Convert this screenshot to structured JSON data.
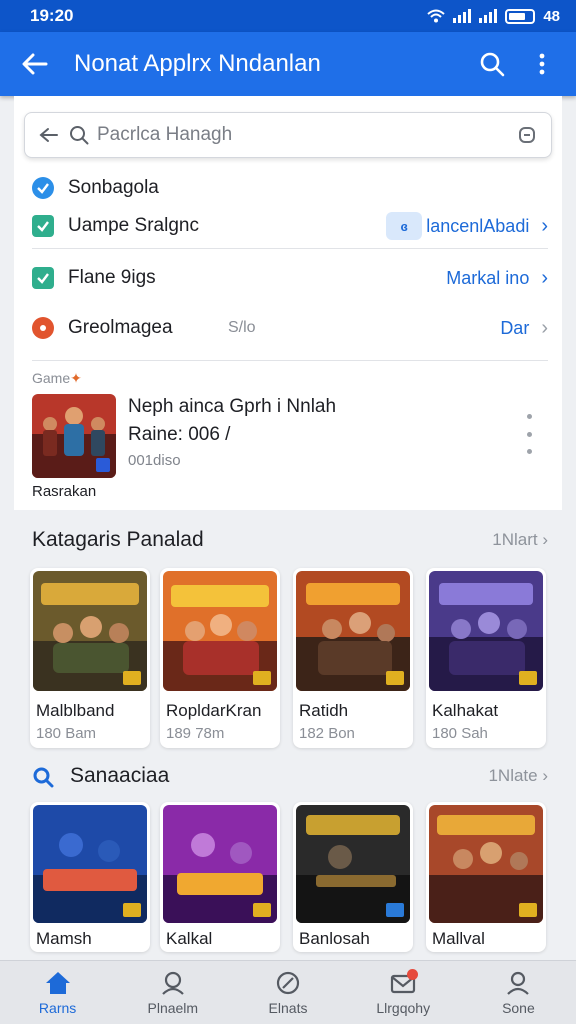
{
  "status_bar": {
    "time": "19:20",
    "battery": "48"
  },
  "app_bar": {
    "title": "Nonat Applrx Nndanlan"
  },
  "search": {
    "placeholder": "Pacrlca Hanagh"
  },
  "options": [
    {
      "label": "Sonbagola",
      "value": ""
    },
    {
      "label": "Uampe Sralgnc",
      "value": "lancenlAbadi"
    },
    {
      "label": "Flane 9igs",
      "value": "Markal ino"
    },
    {
      "label": "Greolmagea",
      "value": "Dar",
      "extra": "S/lo"
    }
  ],
  "game": {
    "section_label": "Game",
    "title": "Neph ainca Gprh i Nnlah",
    "rating": "Raine: 006  /",
    "size": "001diso",
    "subtitle": "Rasrakan"
  },
  "categories": {
    "title": "Katagaris Panalad",
    "more": "1Nlart",
    "cards": [
      {
        "name": "Malblband",
        "meta": "180 Bam"
      },
      {
        "name": "RopldarKran",
        "meta": "189 78m"
      },
      {
        "name": "Ratidh",
        "meta": "182 Bon"
      },
      {
        "name": "Kalhakat",
        "meta": "180 Sah"
      }
    ]
  },
  "recommend": {
    "title": "Sanaaciaa",
    "more": "1Nlate",
    "cards": [
      {
        "name": "Mamsh"
      },
      {
        "name": "Kalkal"
      },
      {
        "name": "Banlosah"
      },
      {
        "name": "Mallval"
      }
    ]
  },
  "nav": [
    {
      "label": "Rarns",
      "icon": "home-icon"
    },
    {
      "label": "Plnaelm",
      "icon": "games-icon"
    },
    {
      "label": "Elnats",
      "icon": "apps-icon"
    },
    {
      "label": "Llrgqohy",
      "icon": "mail-icon"
    },
    {
      "label": "Sone",
      "icon": "profile-icon"
    }
  ],
  "colors": {
    "status_bar": "#0d55c9",
    "app_bar": "#1f6fe8",
    "accent": "#1d6ad8",
    "check_green": "#2fae8d"
  }
}
